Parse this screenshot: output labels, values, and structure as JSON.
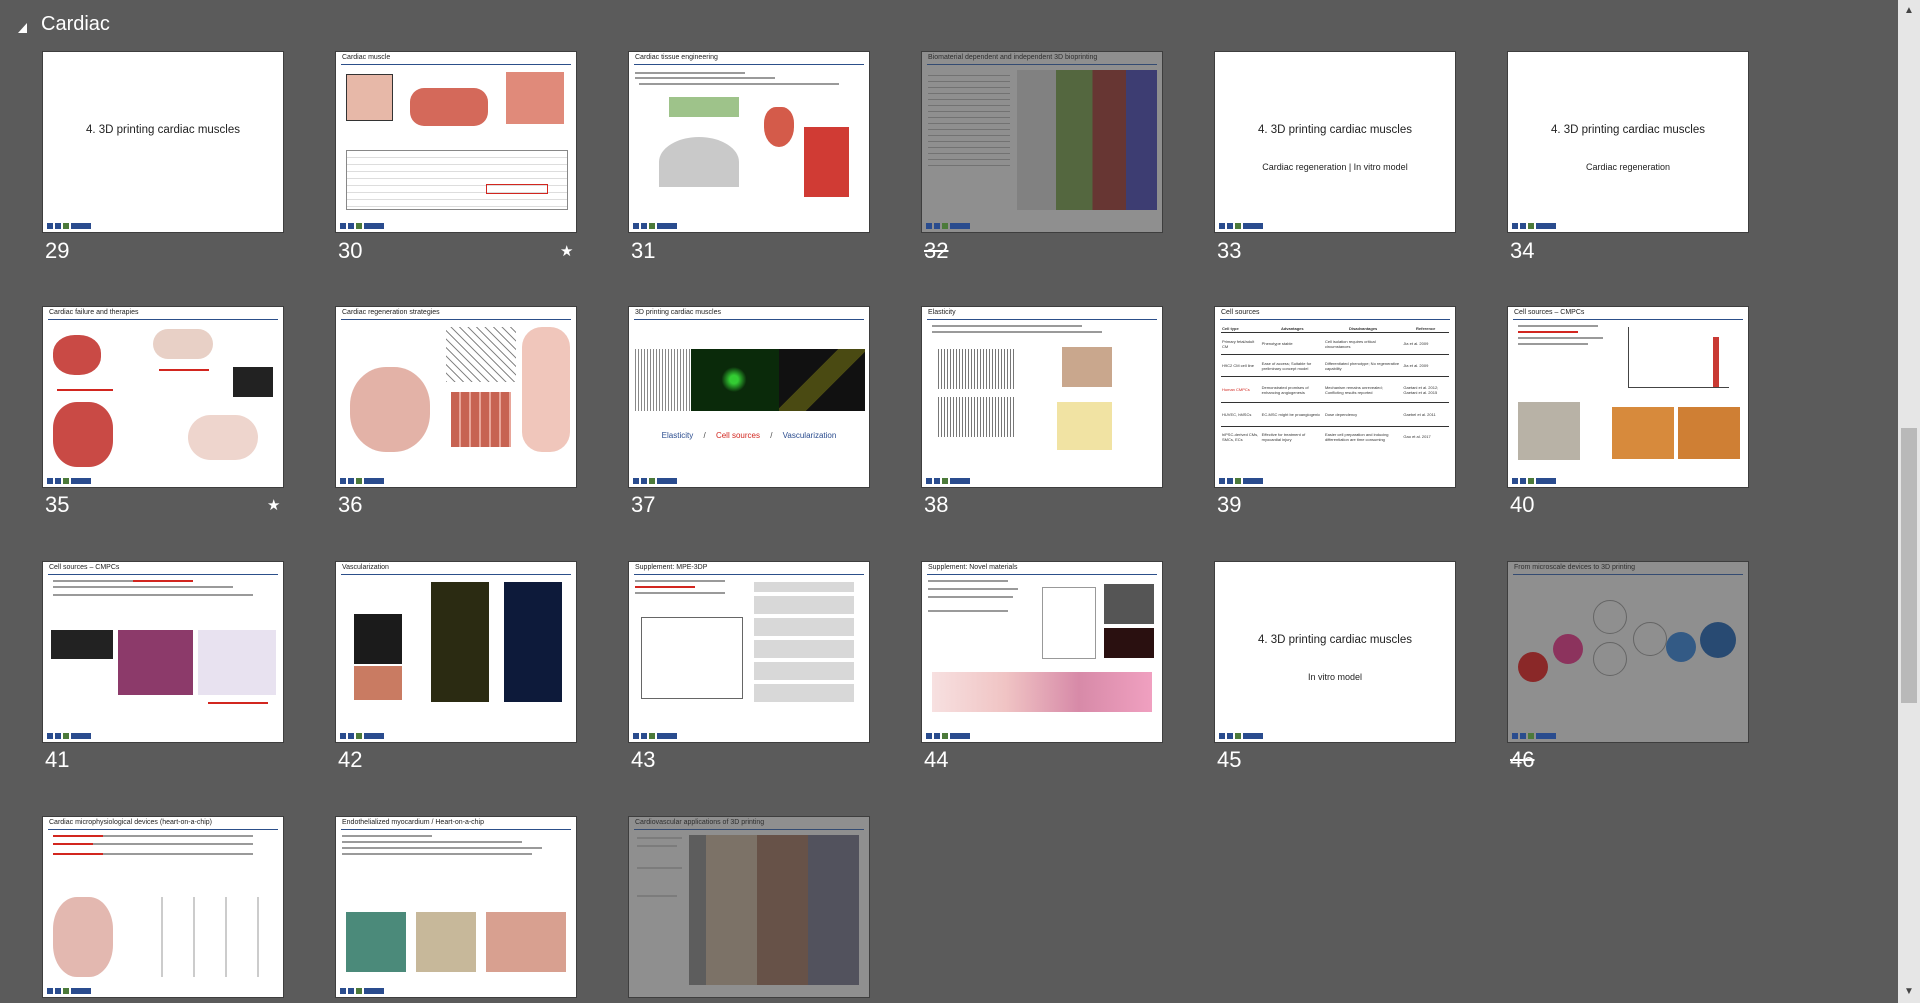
{
  "section": {
    "title": "Cardiac"
  },
  "slides": [
    {
      "num": "29",
      "title": "",
      "center_title": "4. 3D printing cardiac muscles",
      "center_sub": "",
      "hidden": false,
      "star": false
    },
    {
      "num": "30",
      "title": "Cardiac muscle",
      "hidden": false,
      "star": true
    },
    {
      "num": "31",
      "title": "Cardiac tissue engineering",
      "hidden": false,
      "star": false
    },
    {
      "num": "32",
      "title": "Biomaterial dependent and independent 3D bioprinting",
      "hidden": true,
      "star": false
    },
    {
      "num": "33",
      "title": "",
      "center_title": "4. 3D printing cardiac muscles",
      "center_sub": "Cardiac regeneration | In vitro model",
      "hidden": false,
      "star": false
    },
    {
      "num": "34",
      "title": "",
      "center_title": "4. 3D printing cardiac muscles",
      "center_sub": "Cardiac regeneration",
      "hidden": false,
      "star": false
    },
    {
      "num": "35",
      "title": "Cardiac failure and therapies",
      "hidden": false,
      "star": true
    },
    {
      "num": "36",
      "title": "Cardiac regeneration strategies",
      "hidden": false,
      "star": false
    },
    {
      "num": "37",
      "title": "3D printing cardiac muscles",
      "hidden": false,
      "star": false,
      "labels": [
        "Elasticity",
        "/",
        "Cell sources",
        "/",
        "Vascularization"
      ]
    },
    {
      "num": "38",
      "title": "Elasticity",
      "hidden": false,
      "star": false
    },
    {
      "num": "39",
      "title": "Cell sources",
      "hidden": false,
      "star": false
    },
    {
      "num": "40",
      "title": "Cell sources – CMPCs",
      "hidden": false,
      "star": false
    },
    {
      "num": "41",
      "title": "Cell sources – CMPCs",
      "hidden": false,
      "star": false
    },
    {
      "num": "42",
      "title": "Vascularization",
      "hidden": false,
      "star": false
    },
    {
      "num": "43",
      "title": "Supplement: MPE-3DP",
      "hidden": false,
      "star": false
    },
    {
      "num": "44",
      "title": "Supplement: Novel materials",
      "hidden": false,
      "star": false
    },
    {
      "num": "45",
      "title": "",
      "center_title": "4. 3D printing cardiac muscles",
      "center_sub": "In vitro model",
      "hidden": false,
      "star": false
    },
    {
      "num": "46",
      "title": "From microscale devices to 3D printing",
      "hidden": true,
      "star": false
    },
    {
      "num": "47",
      "title": "Cardiac microphysiological devices (heart-on-a-chip)",
      "hidden": false,
      "star": false
    },
    {
      "num": "48",
      "title": "Endothelialized myocardium / Heart-on-a-chip",
      "hidden": false,
      "star": false
    },
    {
      "num": "49",
      "title": "Cardiovascular applications of 3D printing",
      "hidden": true,
      "star": false
    }
  ],
  "slide39_table": {
    "headers": [
      "Cell type",
      "Advantages",
      "Disadvantages",
      "Reference"
    ],
    "rows": [
      [
        "Primary fetal/adult CM",
        "Phenotype stable",
        "Cell isolation requires critical circumstances",
        "Jia et al. 2009"
      ],
      [
        "H9C2 CM cell line",
        "Ease of access; Suitable for preliminary concept model",
        "Differentiated phenotype; No regenerative capability",
        "Jia et al. 2009"
      ],
      [
        "Human CMPCs",
        "Demonstrated promises of enhancing angiogenesis",
        "Mechanism remains unrevealed; Conflicting results reported",
        "Gaetani et al. 2012; Gaetani et al. 2015"
      ],
      [
        "HUVEC, hMSCs",
        "EC-MSC might be proangiogenic",
        "Dose dependency",
        "Gaebel et al. 2011"
      ],
      [
        "hiPSC-derived CMs, SMCs, ECs",
        "Effective for treatment of myocardial injury",
        "Easier cell preparation and inducing differentiation are time consuming",
        "Gao et al. 2017"
      ]
    ]
  },
  "colors": {
    "background": "#5b5b5b",
    "accent_red": "#d2261f",
    "accent_blue": "#2a4c8e"
  }
}
